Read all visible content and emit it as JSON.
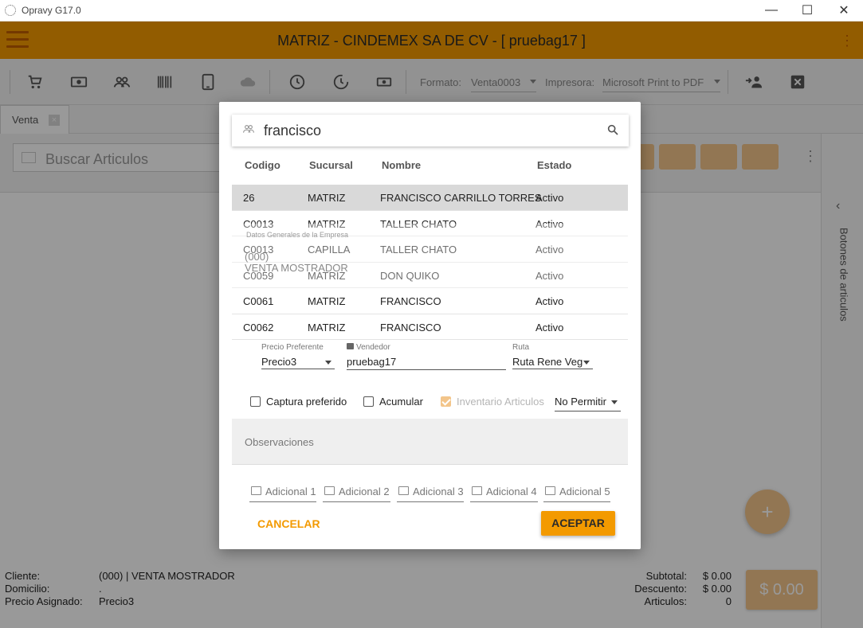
{
  "window": {
    "title": "Opravy G17.0",
    "minimize": "—",
    "maximize": "☐",
    "close": "✕"
  },
  "header": {
    "title": "MATRIZ - CINDEMEX SA DE CV - [ pruebag17 ]",
    "kebab": "⋮"
  },
  "toolbar": {
    "formato_label": "Formato:",
    "formato_value": "Venta0003",
    "impresora_label": "Impresora:",
    "impresora_value": "Microsoft Print to PDF"
  },
  "tabs": [
    {
      "label": "Venta",
      "close": "×"
    }
  ],
  "main": {
    "search_placeholder": "Buscar Articulos",
    "kebab": "⋮"
  },
  "side_panel": {
    "chevron": "‹",
    "label": "Botones de articulos"
  },
  "fab": {
    "label": "+"
  },
  "footer": {
    "cliente_label": "Cliente:",
    "cliente_value": "(000) | VENTA MOSTRADOR",
    "domicilio_label": "Domicilio:",
    "domicilio_value": ".",
    "precio_label": "Precio Asignado:",
    "precio_value": "Precio3",
    "subtotal_label": "Subtotal:",
    "subtotal_value": "$ 0.00",
    "descuento_label": "Descuento:",
    "descuento_value": "$ 0.00",
    "articulos_label": "Articulos:",
    "articulos_value": "0",
    "total": "$ 0.00"
  },
  "dialog": {
    "search_value": "francisco",
    "columns": [
      "Codigo",
      "Sucursal",
      "Nombre",
      "Estado"
    ],
    "rows": [
      {
        "codigo": "26",
        "sucursal": "MATRIZ",
        "nombre": "FRANCISCO CARRILLO TORRES",
        "estado": "Activo"
      },
      {
        "codigo": "C0013",
        "sucursal": "MATRIZ",
        "nombre": "TALLER CHATO",
        "estado": "Activo"
      },
      {
        "codigo": "C0013",
        "sucursal": "CAPILLA",
        "nombre": "TALLER CHATO",
        "estado": "Activo"
      },
      {
        "codigo": "C0059",
        "sucursal": "MATRIZ",
        "nombre": "DON QUIKO",
        "estado": "Activo"
      },
      {
        "codigo": "C0061",
        "sucursal": "MATRIZ",
        "nombre": "FRANCISCO",
        "estado": "Activo"
      },
      {
        "codigo": "C0062",
        "sucursal": "MATRIZ",
        "nombre": "FRANCISCO",
        "estado": "Activo"
      }
    ],
    "ghost": {
      "empresa": "Datos Generales de la Empresa",
      "code": "(000)",
      "name": "VENTA MOSTRADOR"
    },
    "precio_label": "Precio Preferente",
    "precio_value": "Precio3",
    "vendedor_label": "Vendedor",
    "vendedor_value": "pruebag17",
    "ruta_label": "Ruta",
    "ruta_value": "Ruta Rene Veg",
    "captura_label": "Captura preferido",
    "acumular_label": "Acumular",
    "inventario_label": "Inventario Articulos",
    "permitir_value": "No Permitir",
    "observaciones_placeholder": "Observaciones",
    "adicionales": [
      "Adicional 1",
      "Adicional 2",
      "Adicional 3",
      "Adicional 4",
      "Adicional 5"
    ],
    "cancel_label": "CANCELAR",
    "ok_label": "ACEPTAR"
  },
  "colors": {
    "accent": "#f39a00",
    "accent_light": "#f3c58a",
    "selected_row": "#d9d9d9"
  }
}
